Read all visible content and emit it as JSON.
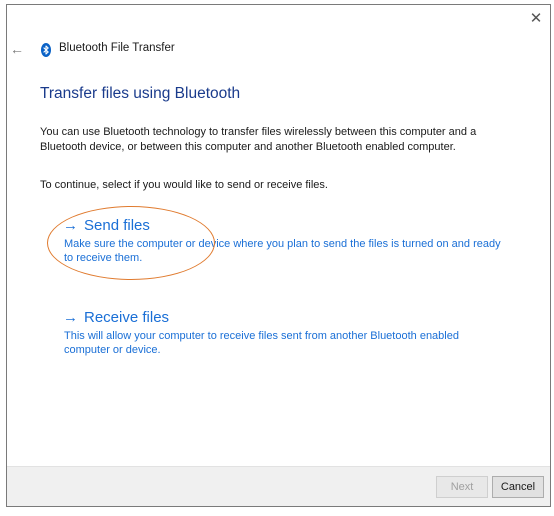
{
  "window": {
    "title": "Bluetooth File Transfer",
    "close_glyph": "✕",
    "back_glyph": "←"
  },
  "heading": "Transfer files using Bluetooth",
  "description": "You can use Bluetooth technology to transfer files wirelessly between this computer and a Bluetooth device, or between this computer and another Bluetooth enabled computer.",
  "instruction": "To continue, select if you would like to send or receive files.",
  "options": [
    {
      "label": "Send files",
      "arrow": "→",
      "description": "Make sure the computer or device where you plan to send the files is turned on and ready to receive them."
    },
    {
      "label": "Receive files",
      "arrow": "→",
      "description": "This will allow your computer to receive files sent from another Bluetooth enabled computer or device."
    }
  ],
  "footer": {
    "next_label": "Next",
    "cancel_label": "Cancel"
  },
  "colors": {
    "heading": "#1a3b8c",
    "link": "#1a6fd6",
    "highlight": "#e07b2f",
    "bluetooth": "#0a62c7"
  },
  "icons": {
    "bluetooth": "bluetooth-icon",
    "back": "back-arrow-icon",
    "close": "close-icon"
  }
}
